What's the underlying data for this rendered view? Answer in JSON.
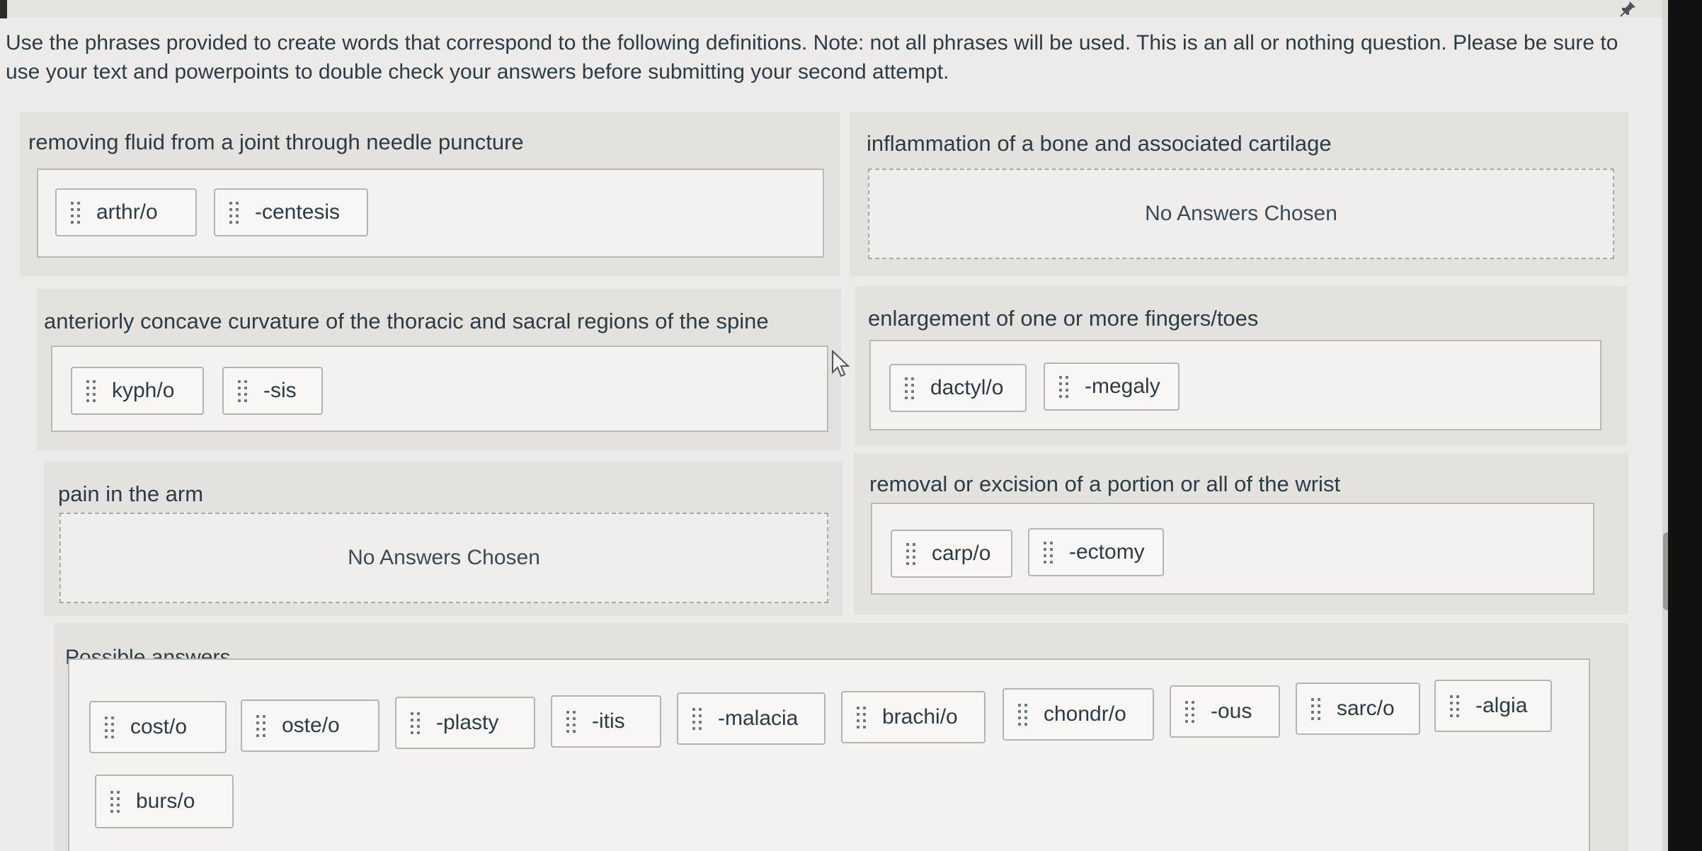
{
  "instructions": "Use the phrases provided to create words that correspond to the following definitions. Note: not all phrases will be used. This is an all or nothing question. Please be sure to use your text and powerpoints to double check your answers before submitting your second attempt.",
  "empty_label": "No Answers Chosen",
  "questions": [
    {
      "prompt": "removing fluid from a joint through needle puncture",
      "answers": [
        "arthr/o",
        "-centesis"
      ]
    },
    {
      "prompt": "inflammation of a bone and associated cartilage",
      "answers": []
    },
    {
      "prompt": "anteriorly concave curvature of the thoracic and sacral regions of the spine",
      "answers": [
        "kyph/o",
        "-sis"
      ]
    },
    {
      "prompt": "enlargement of one or more fingers/toes",
      "answers": [
        "dactyl/o",
        "-megaly"
      ]
    },
    {
      "prompt": "pain in the arm",
      "answers": []
    },
    {
      "prompt": "removal or excision of a portion or all of the wrist",
      "answers": [
        "carp/o",
        "-ectomy"
      ]
    }
  ],
  "possible_answers_label": "Possible answers",
  "possible_answers": [
    "cost/o",
    "oste/o",
    "-plasty",
    "-itis",
    "-malacia",
    "brachi/o",
    "chondr/o",
    "-ous",
    "sarc/o",
    "-algia",
    "burs/o"
  ],
  "icons": {
    "drag": "drag-handle-icon",
    "pin": "pin-icon"
  }
}
